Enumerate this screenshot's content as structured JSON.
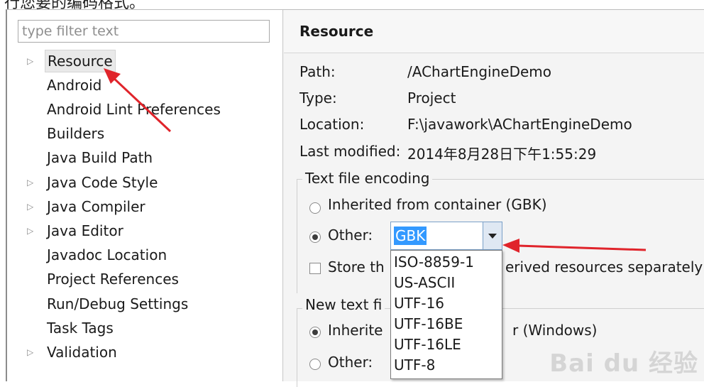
{
  "top_text": "行您要的编码格式。",
  "filter": {
    "placeholder": "type filter text"
  },
  "tree": [
    {
      "label": "Resource",
      "expandable": true
    },
    {
      "label": "Android",
      "expandable": false
    },
    {
      "label": "Android Lint Preferences",
      "expandable": false
    },
    {
      "label": "Builders",
      "expandable": false
    },
    {
      "label": "Java Build Path",
      "expandable": false
    },
    {
      "label": "Java Code Style",
      "expandable": true
    },
    {
      "label": "Java Compiler",
      "expandable": true
    },
    {
      "label": "Java Editor",
      "expandable": true
    },
    {
      "label": "Javadoc Location",
      "expandable": false
    },
    {
      "label": "Project References",
      "expandable": false
    },
    {
      "label": "Run/Debug Settings",
      "expandable": false
    },
    {
      "label": "Task Tags",
      "expandable": false
    },
    {
      "label": "Validation",
      "expandable": true
    }
  ],
  "page": {
    "title": "Resource",
    "props": [
      {
        "key": "Path:",
        "value": "/AChartEngineDemo"
      },
      {
        "key": "Type:",
        "value": "Project"
      },
      {
        "key": "Location:",
        "value": "F:\\javawork\\AChartEngineDemo"
      },
      {
        "key": "Last modified:",
        "value": "2014年8月28日下午1:55:29"
      }
    ],
    "encoding": {
      "title": "Text file encoding",
      "inherited": "Inherited from container (GBK)",
      "other": "Other:",
      "selected": "GBK",
      "store_partial_left": "Store th",
      "store_partial_right": "erived resources separately",
      "options": [
        "ISO-8859-1",
        "US-ASCII",
        "UTF-16",
        "UTF-16BE",
        "UTF-16LE",
        "UTF-8"
      ]
    },
    "line_delim": {
      "title_partial": "New text fi",
      "inherited_partial": "Inherite",
      "inherited_right": "r (Windows)",
      "other": "Other:"
    }
  },
  "watermark": "Bai du 经验",
  "colors": {
    "selection": "#3399ff",
    "arrow": "#e0242b"
  }
}
